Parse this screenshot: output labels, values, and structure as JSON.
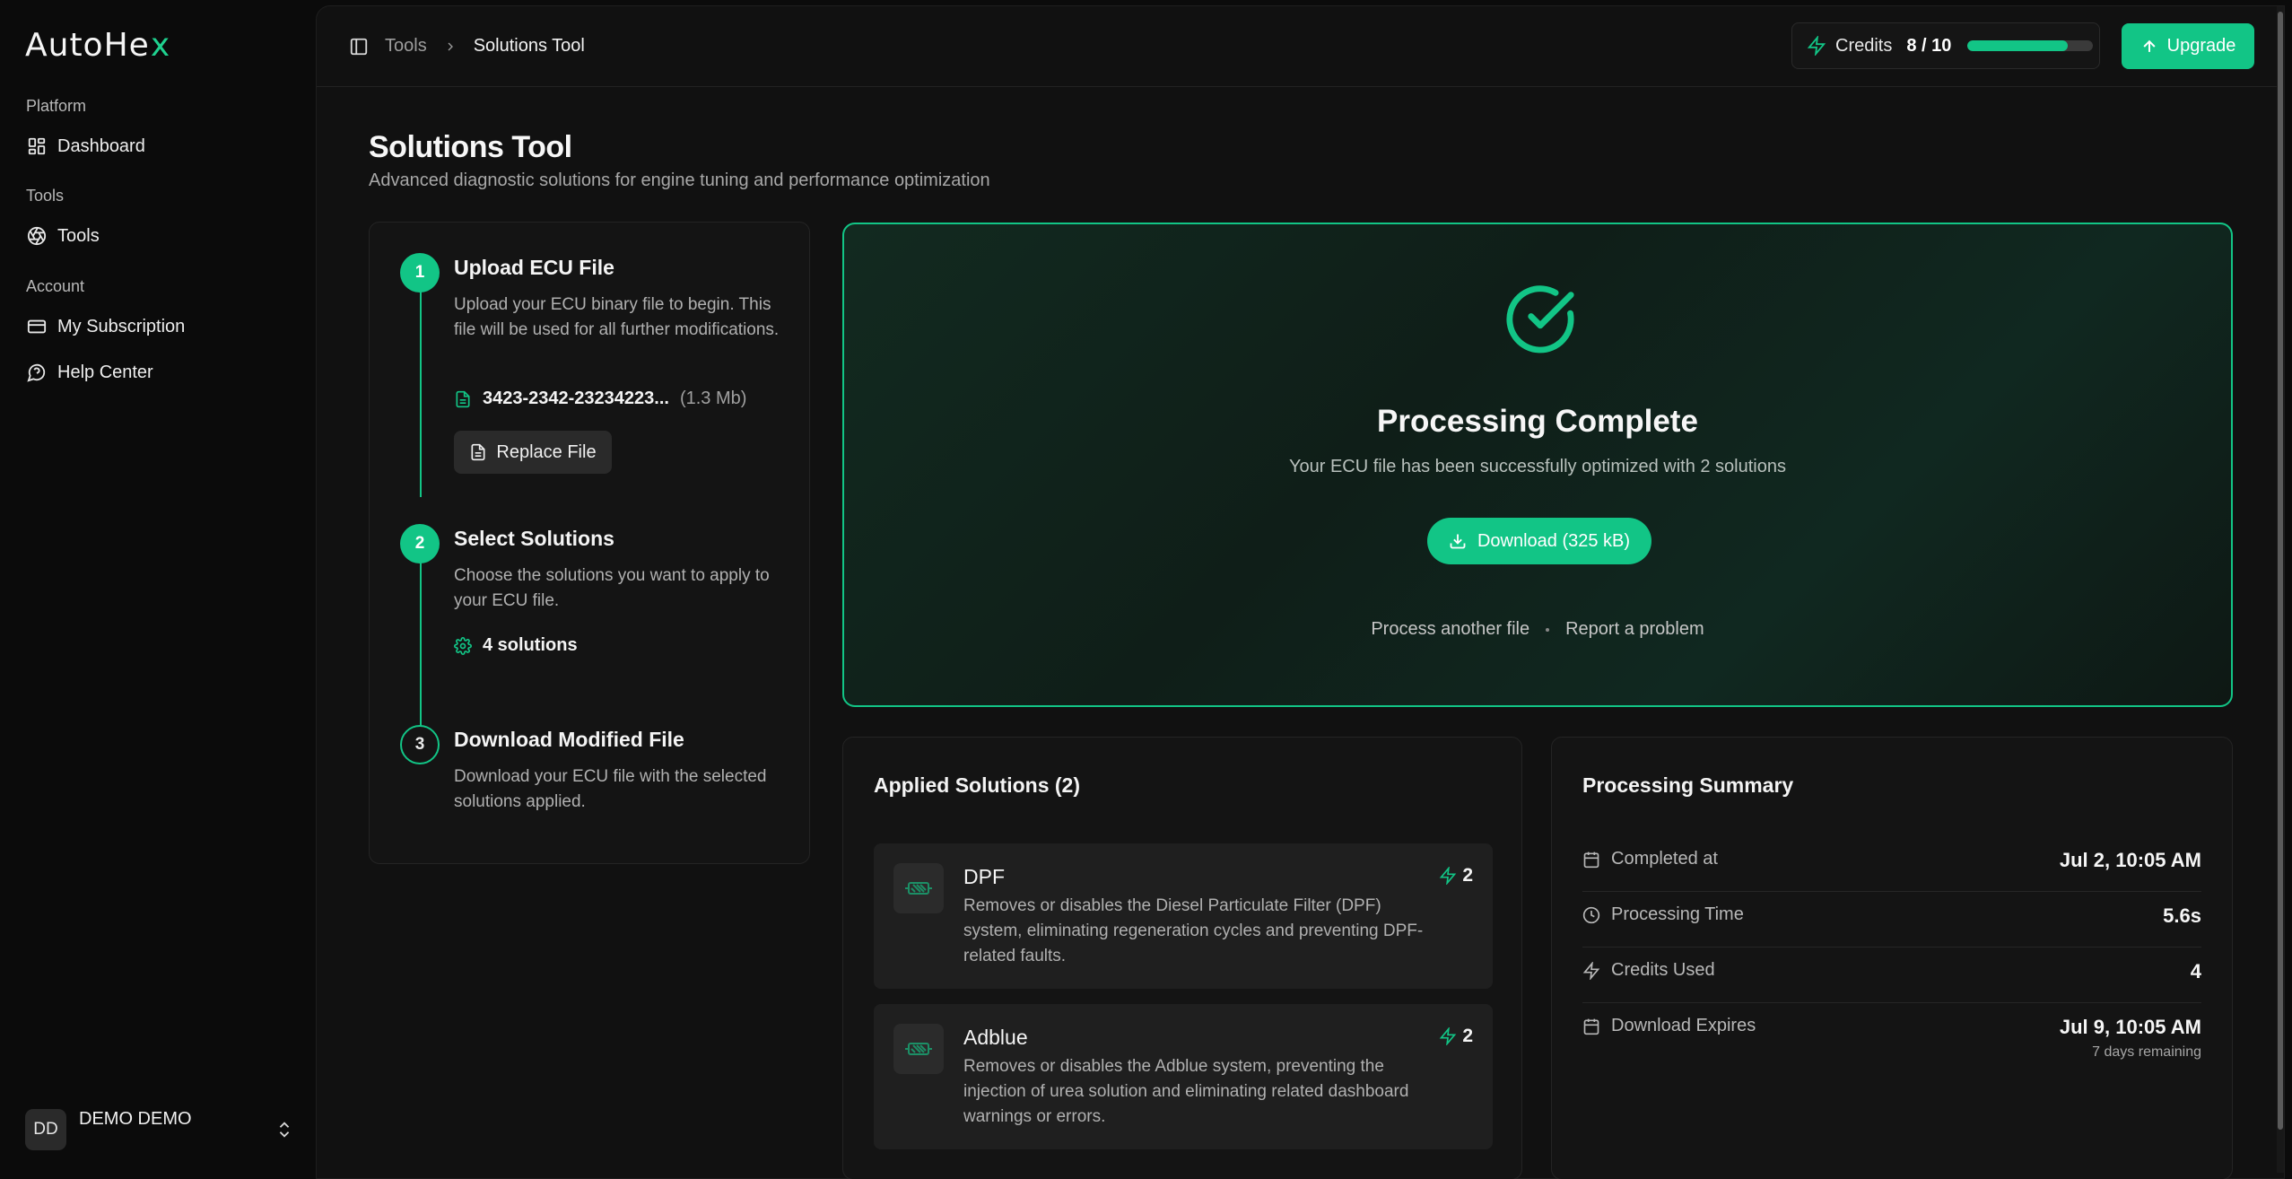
{
  "brand": {
    "name": "AutoHe",
    "accent_letter": "x",
    "accent_color": "#1fd18f"
  },
  "sidebar": {
    "groups": [
      {
        "label": "Platform",
        "items": [
          {
            "label": "Dashboard",
            "icon": "grid-icon"
          }
        ]
      },
      {
        "label": "Tools",
        "items": [
          {
            "label": "Tools",
            "icon": "aperture-icon"
          }
        ]
      },
      {
        "label": "Account",
        "items": [
          {
            "label": "My Subscription",
            "icon": "credit-card-icon"
          },
          {
            "label": "Help Center",
            "icon": "help-chat-icon"
          }
        ]
      }
    ],
    "user": {
      "initials": "DD",
      "name": "DEMO DEMO"
    }
  },
  "topbar": {
    "breadcrumb": [
      "Tools",
      "Solutions Tool"
    ],
    "credits": {
      "label": "Credits",
      "value": "8 / 10",
      "used_fraction": 0.8
    },
    "upgrade_label": "Upgrade"
  },
  "page": {
    "title": "Solutions Tool",
    "subtitle": "Advanced diagnostic solutions for engine tuning and performance optimization"
  },
  "steps": [
    {
      "number": "1",
      "title": "Upload ECU File",
      "description": "Upload your ECU binary file to begin. This file will be used for all further modifications.",
      "file_name": "3423-2342-23234223...",
      "file_size": "(1.3 Mb)",
      "button_label": "Replace File"
    },
    {
      "number": "2",
      "title": "Select Solutions",
      "description": "Choose the solutions you want to apply to your ECU file.",
      "solutions_count": "4 solutions"
    },
    {
      "number": "3",
      "title": "Download Modified File",
      "description": "Download your ECU file with the selected solutions applied."
    }
  ],
  "complete": {
    "title": "Processing Complete",
    "subtitle": "Your ECU file has been successfully optimized with 2 solutions",
    "download_label": "Download (325 kB)",
    "link_process_another": "Process another file",
    "link_report": "Report a problem"
  },
  "applied": {
    "title": "Applied Solutions (2)",
    "items": [
      {
        "name": "DPF",
        "description": "Removes or disables the Diesel Particulate Filter (DPF) system, eliminating regeneration cycles and preventing DPF-related faults.",
        "credits": "2"
      },
      {
        "name": "Adblue",
        "description": "Removes or disables the Adblue system, preventing the injection of urea solution and eliminating related dashboard warnings or errors.",
        "credits": "2"
      }
    ]
  },
  "summary": {
    "title": "Processing Summary",
    "rows": [
      {
        "label": "Completed at",
        "value": "Jul 2, 10:05 AM",
        "icon": "calendar-icon"
      },
      {
        "label": "Processing Time",
        "value": "5.6s",
        "icon": "clock-icon"
      },
      {
        "label": "Credits Used",
        "value": "4",
        "icon": "lightning-icon"
      },
      {
        "label": "Download Expires",
        "value": "Jul 9, 10:05 AM",
        "note": "7 days remaining",
        "icon": "calendar-icon"
      }
    ]
  }
}
